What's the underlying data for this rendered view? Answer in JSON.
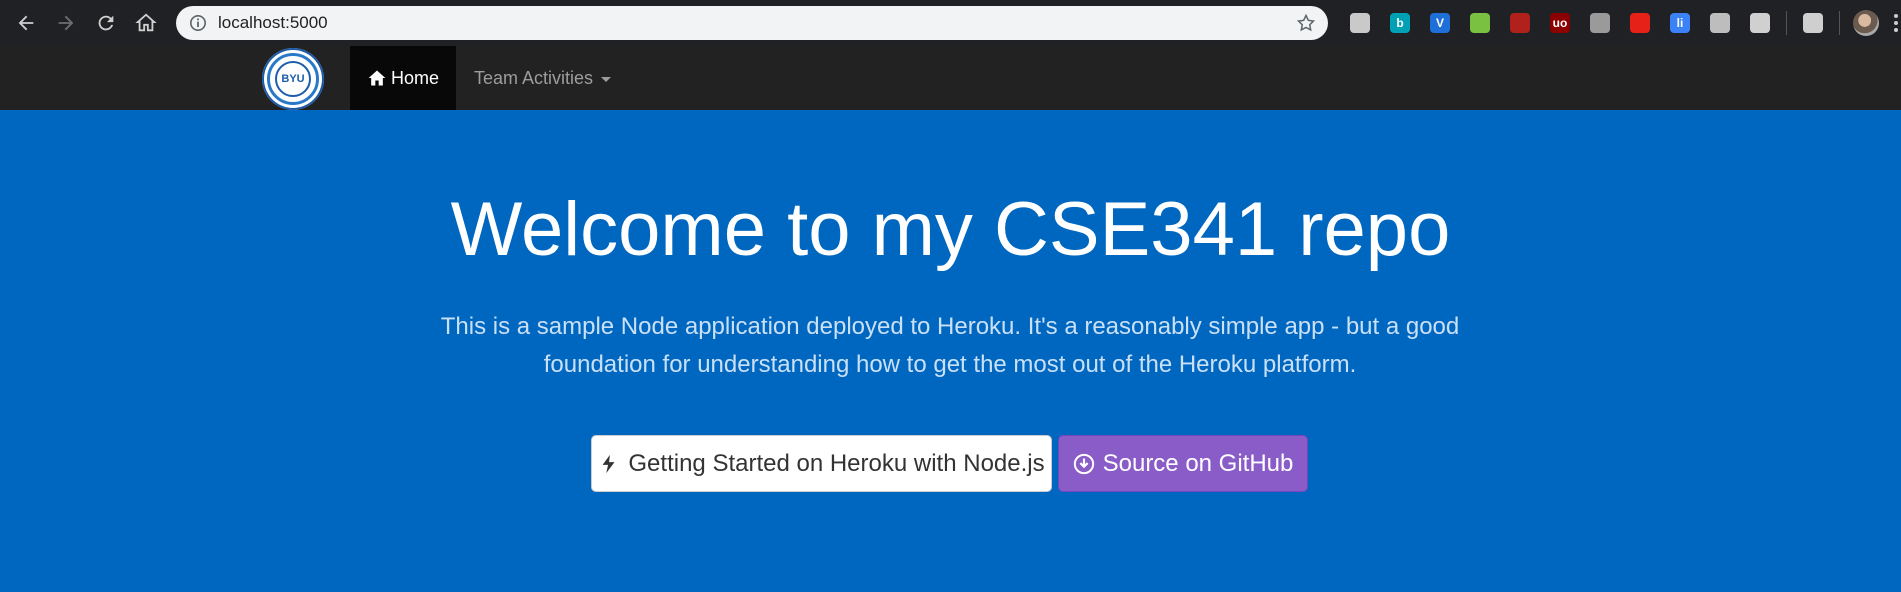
{
  "browser": {
    "url": "localhost:5000",
    "nav": {
      "back_icon": "arrow-left-icon",
      "forward_icon": "arrow-right-icon",
      "reload_icon": "reload-icon",
      "home_icon": "home-icon"
    },
    "extensions": [
      {
        "name": "location-pin-icon",
        "color": "#c9c9c9"
      },
      {
        "name": "bing-icon",
        "color": "#00a1b5",
        "glyph": "b"
      },
      {
        "name": "vivaldi-icon",
        "color": "#1f6fd8",
        "glyph": "V"
      },
      {
        "name": "evernote-icon",
        "color": "#7ac142"
      },
      {
        "name": "pdf-icon",
        "color": "#b0211b"
      },
      {
        "name": "ublock-icon",
        "color": "#8b0000",
        "glyph": "uo"
      },
      {
        "name": "media-icon",
        "color": "#9a9a9a"
      },
      {
        "name": "youtube-icon",
        "color": "#e62117"
      },
      {
        "name": "bar-icon",
        "color": "#3b82f6",
        "glyph": "li"
      },
      {
        "name": "gear-icon",
        "color": "#bdbdbd"
      },
      {
        "name": "react-icon",
        "color": "#d0d0d0"
      },
      {
        "name": "playlist-icon",
        "color": "#cfcfcf"
      }
    ]
  },
  "site_nav": {
    "logo_text": "BYU",
    "home_label": "Home",
    "team_label": "Team Activities"
  },
  "hero": {
    "title": "Welcome to my CSE341 repo",
    "lead": "This is a sample Node application deployed to Heroku. It's a reasonably simple app - but a good foundation for understanding how to get the most out of the Heroku platform.",
    "buttons": {
      "getting_started": "Getting Started on Heroku with Node.js",
      "source": "Source on GitHub"
    }
  },
  "colors": {
    "hero_bg": "#0067c0",
    "navbar_bg": "#222222",
    "purple_button": "#8a5cc8"
  }
}
